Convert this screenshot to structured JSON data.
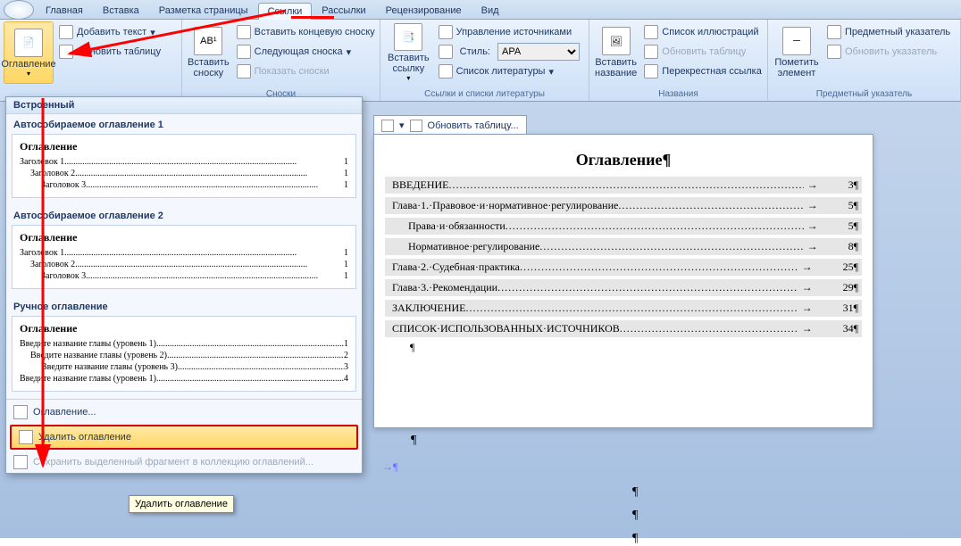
{
  "tabs": {
    "home": "Главная",
    "insert": "Вставка",
    "layout": "Разметка страницы",
    "references": "Ссылки",
    "mailings": "Рассылки",
    "review": "Рецензирование",
    "view": "Вид"
  },
  "ribbon": {
    "toc": {
      "btn": "Оглавление",
      "add": "Добавить текст",
      "update": "Обновить таблицу"
    },
    "footnotes": {
      "btn": "Вставить\nсноску",
      "endnote": "Вставить концевую сноску",
      "next": "Следующая сноска",
      "show": "Показать сноски",
      "label": "Сноски"
    },
    "citations": {
      "btn": "Вставить\nссылку",
      "manage": "Управление источниками",
      "style_lbl": "Стиль:",
      "style_val": "APA",
      "bib": "Список литературы",
      "label": "Ссылки и списки литературы"
    },
    "captions": {
      "btn": "Вставить\nназвание",
      "figlist": "Список иллюстраций",
      "update": "Обновить таблицу",
      "xref": "Перекрестная ссылка",
      "label": "Названия"
    },
    "index": {
      "btn": "Пометить\nэлемент",
      "idx": "Предметный указатель",
      "update": "Обновить указатель",
      "label": "Предметный указатель"
    }
  },
  "dropdown": {
    "header": "Встроенный",
    "auto1": "Автособираемое оглавление 1",
    "auto2": "Автособираемое оглавление 2",
    "manual": "Ручное оглавление",
    "preview_title": "Оглавление",
    "h1": "Заголовок 1",
    "h2": "Заголовок 2",
    "h3": "Заголовок 3",
    "m1": "Введите название главы (уровень 1)",
    "m2": "Введите название главы (уровень 2)",
    "m3": "Введите название главы (уровень 3)",
    "m1b": "Введите название главы (уровень 1)",
    "p1": "1",
    "p2": "2",
    "p3": "3",
    "p4": "4",
    "menu_toc": "Оглавление...",
    "menu_delete": "Удалить оглавление",
    "menu_save": "Сохранить выделенный фрагмент в коллекцию оглавлений...",
    "tooltip": "Удалить оглавление"
  },
  "doc": {
    "update_btn": "Обновить таблицу...",
    "title": "Оглавление¶",
    "lines": [
      {
        "text": "ВВЕДЕНИЕ",
        "page": "3¶",
        "indent": 0
      },
      {
        "text": "Глава·1.·Правовое·и·нормативное·регулирование",
        "page": "5¶",
        "indent": 0
      },
      {
        "text": "Права·и·обязанности",
        "page": "5¶",
        "indent": 1
      },
      {
        "text": "Нормативное·регулирование",
        "page": "8¶",
        "indent": 1
      },
      {
        "text": "Глава·2.·Судебная·практика",
        "page": "25¶",
        "indent": 0
      },
      {
        "text": "Глава·3.·Рекомендации",
        "page": "29¶",
        "indent": 0
      },
      {
        "text": "ЗАКЛЮЧЕНИЕ",
        "page": "31¶",
        "indent": 0
      },
      {
        "text": "СПИСОК·ИСПОЛЬЗОВАННЫХ·ИСТОЧНИКОВ",
        "page": "34¶",
        "indent": 0
      }
    ],
    "para": "¶"
  }
}
